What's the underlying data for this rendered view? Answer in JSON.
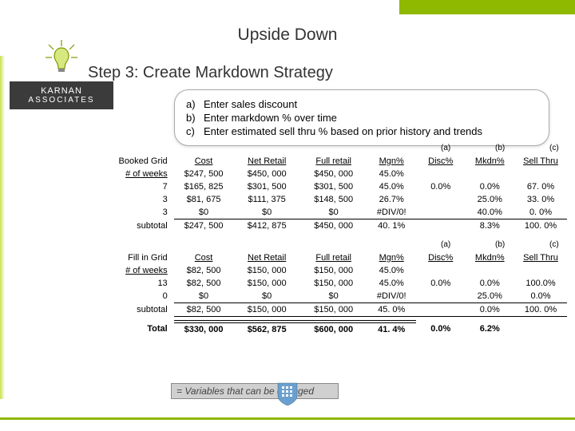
{
  "doc_title": "Upside Down",
  "logo": {
    "line1": "KARNAN",
    "line2": "ASSOCIATES"
  },
  "step_title": "Step 3: Create Markdown Strategy",
  "instructions": [
    {
      "label": "a)",
      "text": "Enter sales discount"
    },
    {
      "label": "b)",
      "text": "Enter markdown % over time"
    },
    {
      "label": "c)",
      "text": "Enter estimated sell thru % based on prior history and trends"
    }
  ],
  "abc_labels": {
    "a": "(a)",
    "b": "(b)",
    "c": "(c)"
  },
  "headers": {
    "cost": "Cost",
    "net": "Net Retail",
    "full": "Full retail",
    "mgn": "Mgn%",
    "disc": "Disc%",
    "mkdn": "Mkdn%",
    "sell": "Sell Thru"
  },
  "booked": {
    "title": "Booked Grid",
    "rowlabel": "# of weeks",
    "summary": {
      "cost": "$247, 500",
      "net": "$450, 000",
      "full": "$450, 000",
      "mgn": "45.0%"
    },
    "rows": [
      {
        "wk": "7",
        "cost": "$165, 825",
        "net": "$301, 500",
        "full": "$301, 500",
        "mgn": "45.0%",
        "disc": "0.0%",
        "mkdn": "0.0%",
        "sell": "67. 0%"
      },
      {
        "wk": "3",
        "cost": "$81, 675",
        "net": "$111, 375",
        "full": "$148, 500",
        "mgn": "26.7%",
        "disc": "",
        "mkdn": "25.0%",
        "sell": "33. 0%"
      },
      {
        "wk": "3",
        "cost": "$0",
        "net": "$0",
        "full": "$0",
        "mgn": "#DIV/0!",
        "disc": "",
        "mkdn": "40.0%",
        "sell": "0. 0%"
      }
    ],
    "subtotal": {
      "label": "subtotal",
      "cost": "$247, 500",
      "net": "$412, 875",
      "full": "$450, 000",
      "mgn": "40. 1%",
      "disc": "",
      "mkdn": "8.3%",
      "sell": "100. 0%"
    }
  },
  "fill": {
    "title": "Fill in Grid",
    "rowlabel": "# of weeks",
    "summary": {
      "cost": "$82, 500",
      "net": "$150, 000",
      "full": "$150, 000",
      "mgn": "45.0%"
    },
    "rows": [
      {
        "wk": "13",
        "cost": "$82, 500",
        "net": "$150, 000",
        "full": "$150, 000",
        "mgn": "45.0%",
        "disc": "0.0%",
        "mkdn": "0.0%",
        "sell": "100.0%"
      },
      {
        "wk": "0",
        "cost": "$0",
        "net": "$0",
        "full": "$0",
        "mgn": "#DIV/0!",
        "disc": "",
        "mkdn": "25.0%",
        "sell": "0.0%"
      }
    ],
    "subtotal": {
      "label": "subtotal",
      "cost": "$82, 500",
      "net": "$150, 000",
      "full": "$150, 000",
      "mgn": "45. 0%",
      "disc": "",
      "mkdn": "0.0%",
      "sell": "100. 0%"
    }
  },
  "total": {
    "label": "Total",
    "cost": "$330, 000",
    "net": "$562, 875",
    "full": "$600, 000",
    "mgn": "41. 4%",
    "disc": "0.0%",
    "mkdn": "6.2%"
  },
  "legend": "= Variables that can be changed"
}
